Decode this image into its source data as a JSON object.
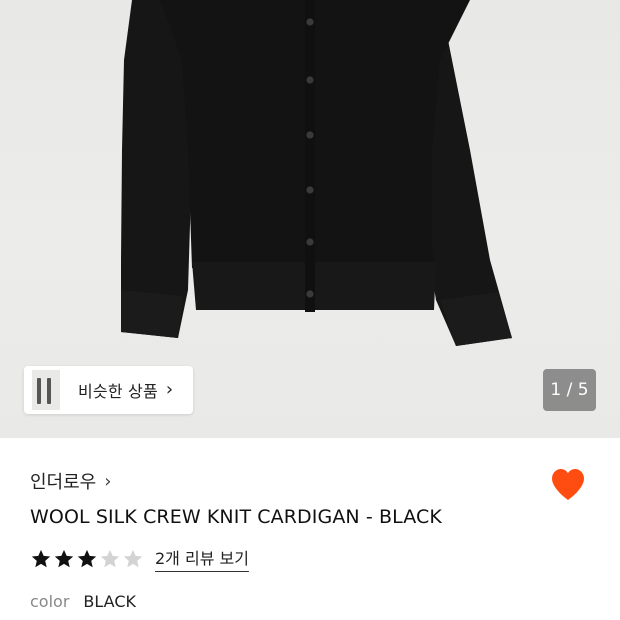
{
  "gallery": {
    "similar_label": "비슷한 상품",
    "similar_chevron": "›",
    "pager": "1 / 5"
  },
  "product": {
    "brand": "인더로우",
    "brand_chevron": "›",
    "title": "WOOL SILK CREW KNIT CARDIGAN - BLACK",
    "rating": {
      "value": 3,
      "max": 5,
      "review_link": "2개 리뷰 보기"
    },
    "color": {
      "label": "color",
      "value": "BLACK"
    },
    "wishlisted": true
  },
  "colors": {
    "heart": "#ff4d12",
    "star_filled": "#111111",
    "star_empty": "#d3d3d3",
    "garment": "#141414"
  },
  "icons": [
    "chevron-right-icon",
    "heart-icon",
    "star-icon"
  ]
}
